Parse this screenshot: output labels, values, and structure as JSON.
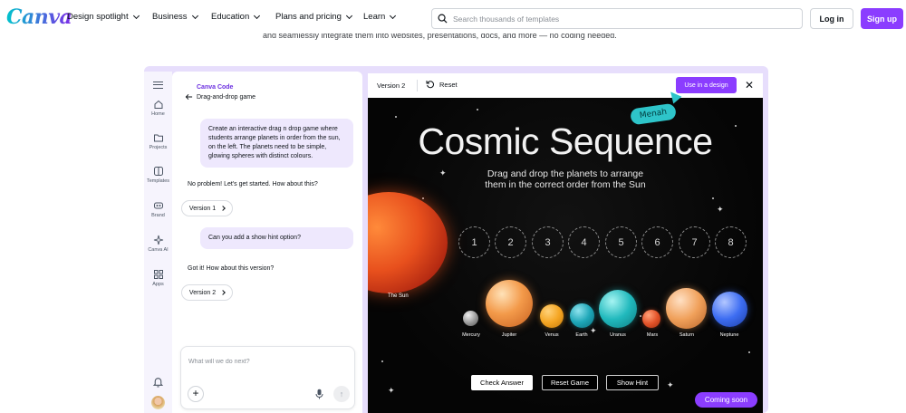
{
  "nav": {
    "logo": "Canva",
    "items": [
      {
        "label": "Design spotlight"
      },
      {
        "label": "Business"
      },
      {
        "label": "Education"
      },
      {
        "label": "Plans and pricing"
      },
      {
        "label": "Learn"
      }
    ],
    "search_placeholder": "Search thousands of templates",
    "login_label": "Log in",
    "signup_label": "Sign up"
  },
  "hero_partial_text": "and seamlessly integrate them into websites, presentations, docs, and more — no coding needed.",
  "rail": {
    "items": [
      {
        "label": "Home",
        "icon": "home-icon"
      },
      {
        "label": "Projects",
        "icon": "folder-icon"
      },
      {
        "label": "Templates",
        "icon": "templates-icon"
      },
      {
        "label": "Brand",
        "icon": "brand-icon"
      },
      {
        "label": "Canva AI",
        "icon": "sparkle-icon"
      },
      {
        "label": "Apps",
        "icon": "apps-icon"
      }
    ]
  },
  "chat": {
    "brand": "Canva Code",
    "title": "Drag-and-drop game",
    "messages": {
      "user_1": "Create an interactive drag n drop game where students arrange planets in order from the sun, on the left. The planets need to be simple, glowing spheres with distinct colours.",
      "ai_1": "No problem! Let's get started. How about this?",
      "version_1": "Version 1",
      "user_2": "Can you add a show hint option?",
      "ai_2": "Got it! How about this version?",
      "version_2": "Version 2"
    },
    "composer_placeholder": "What will we do next?"
  },
  "preview": {
    "version_label": "Version 2",
    "reset_label": "Reset",
    "use_button": "Use in a design",
    "collaborator": "Menah",
    "coming_soon": "Coming soon"
  },
  "game": {
    "title": "Cosmic Sequence",
    "subtitle_line1": "Drag and drop the planets to arrange",
    "subtitle_line2": "them in the correct order from the Sun",
    "sun_label": "The Sun",
    "slots": [
      "1",
      "2",
      "3",
      "4",
      "5",
      "6",
      "7",
      "8"
    ],
    "planets": [
      {
        "name": "Mercury",
        "color": "#9a9a9a"
      },
      {
        "name": "Jupiter",
        "color": "#f08a3c"
      },
      {
        "name": "Venus",
        "color": "#f5a623"
      },
      {
        "name": "Earth",
        "color": "#1ea7b8"
      },
      {
        "name": "Uranus",
        "color": "#21b9bd"
      },
      {
        "name": "Mars",
        "color": "#e4542a"
      },
      {
        "name": "Saturn",
        "color": "#f0a05a"
      },
      {
        "name": "Neptune",
        "color": "#3d6df2"
      }
    ],
    "buttons": {
      "check": "Check Answer",
      "reset": "Reset Game",
      "hint": "Show Hint"
    }
  },
  "colors": {
    "brand_purple": "#8b3dff",
    "frame_bg": "#e7defc",
    "bubble_bg": "#eee8fd"
  }
}
